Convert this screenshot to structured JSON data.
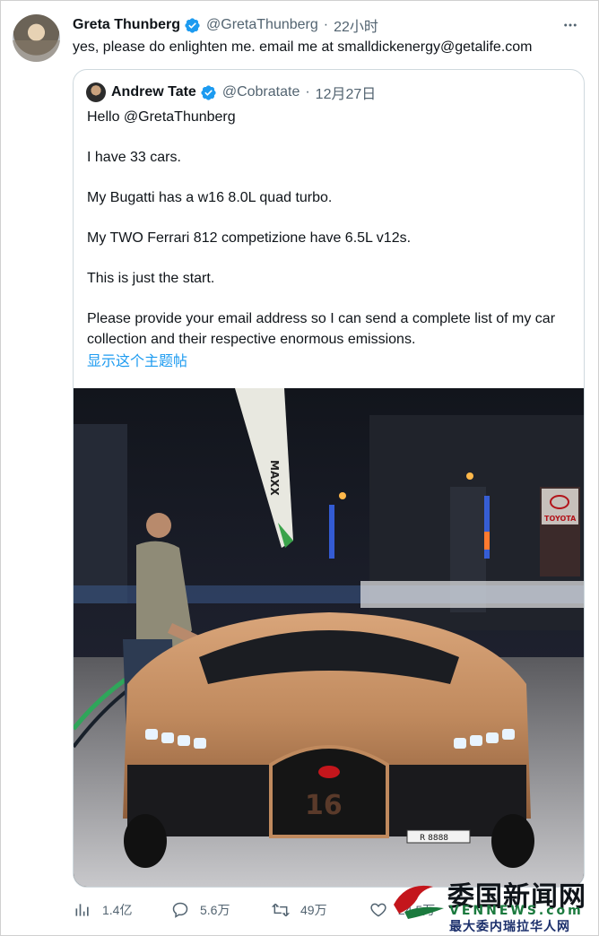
{
  "tweet": {
    "author_name": "Greta Thunberg",
    "author_handle": "@GretaThunberg",
    "separator": "·",
    "time": "22小时",
    "text": "yes, please do enlighten me. email me at smalldickenergy@getalife.com",
    "icons": {
      "avatar": "avatar",
      "verified": "verified-badge-icon",
      "more": "more-options-icon"
    }
  },
  "quoted": {
    "author_name": "Andrew Tate",
    "author_handle": "@Cobratate",
    "separator": "·",
    "time": "12月27日",
    "lines": [
      "Hello @GretaThunberg",
      "I have 33 cars.",
      "My Bugatti has a w16 8.0L quad turbo.",
      "My TWO Ferrari 812 competizione have 6.5L v12s.",
      "This is just the start.",
      "Please provide your email address so I can send a complete list of my car collection and their respective enormous emissions."
    ],
    "show_thread": "显示这个主题帖",
    "photo": {
      "banner_text": "MAXX",
      "sign_text": "TOYOTA",
      "plate_text": "R 8888",
      "badge_number": "16"
    }
  },
  "actions": {
    "views": "1.4亿",
    "replies": "5.6万",
    "retweets": "49万",
    "likes": "24.5万"
  },
  "watermark": {
    "logo_text": "委国新闻网",
    "site": "VENNEWS.com",
    "slogan": "最大委内瑞拉华人网"
  },
  "colors": {
    "link": "#1d9bf0",
    "verified": "#1d9bf0",
    "muted_text": "#536471",
    "border": "#cfd9de",
    "car_body": "#c08a5e"
  }
}
